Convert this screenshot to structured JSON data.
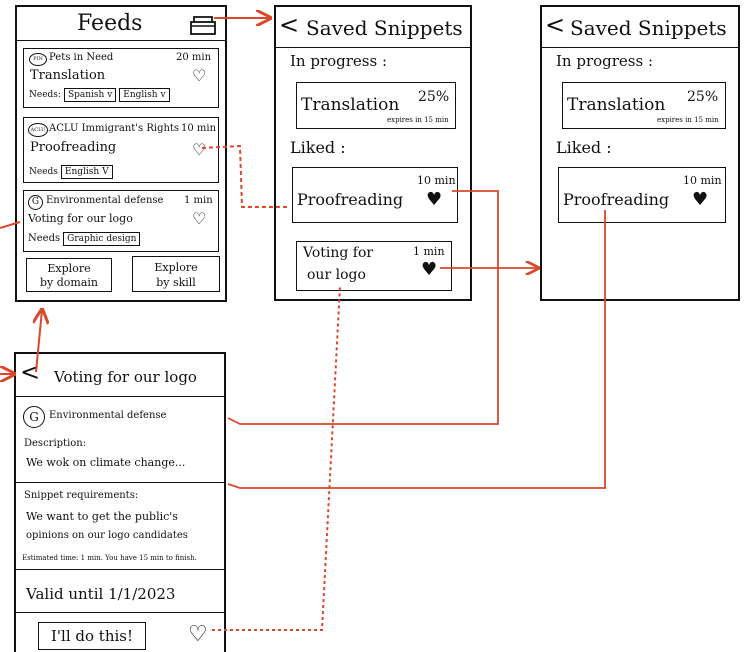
{
  "feeds": {
    "title": "Feeds",
    "icon": "inbox-icon",
    "cards": [
      {
        "org": "Pets in Need",
        "org_icon_text": "PIN",
        "time": "20 min",
        "task": "Translation",
        "needs_label": "Needs:",
        "needs": [
          "Spanish v",
          "English v"
        ],
        "liked": false
      },
      {
        "org": "ACLU Immigrant's Rights",
        "org_icon_text": "ACLU",
        "time": "10 min",
        "task": "Proofreading",
        "needs_label": "Needs",
        "needs": [
          "English V"
        ],
        "liked": true
      },
      {
        "org": "Environmental defense",
        "org_icon_text": "G",
        "time": "1 min",
        "task": "Voting for our logo",
        "needs_label": "Needs",
        "needs": [
          "Graphic design"
        ],
        "liked": false
      }
    ],
    "explore_domain": [
      "Explore",
      "by domain"
    ],
    "explore_skill": [
      "Explore",
      "by skill"
    ]
  },
  "saved1": {
    "back": "<",
    "title": "Saved Snippets",
    "in_progress_label": "In progress :",
    "progress_task": "Translation",
    "progress_pct": "25%",
    "progress_expiry": "expires in 15 min",
    "liked_label": "Liked :",
    "liked_items": [
      {
        "task": "Proofreading",
        "time": "10 min"
      },
      {
        "task_line1": "Voting for",
        "task_line2": "our logo",
        "time": "1 min"
      }
    ]
  },
  "saved2": {
    "back": "<",
    "title": "Saved Snippets",
    "in_progress_label": "In progress :",
    "progress_task": "Translation",
    "progress_pct": "25%",
    "progress_expiry": "expires in 15 min",
    "liked_label": "Liked :",
    "liked_item": {
      "task": "Proofreading",
      "time": "10 min"
    }
  },
  "detail": {
    "back": "<",
    "title": "Voting for our logo",
    "org_icon_text": "G",
    "org": "Environmental defense",
    "description_label": "Description:",
    "description": "We wok on climate change...",
    "req_label": "Snippet requirements:",
    "req_line1": "We want to get the public's",
    "req_line2": "opinions on our logo candidates",
    "estimated": "Estimated time: 1 min. You have 15 min to finish.",
    "valid_until": "Valid until 1/1/2023",
    "cta": "I'll do this!"
  },
  "colors": {
    "ink": "#111111",
    "flow": "#d9482b"
  }
}
